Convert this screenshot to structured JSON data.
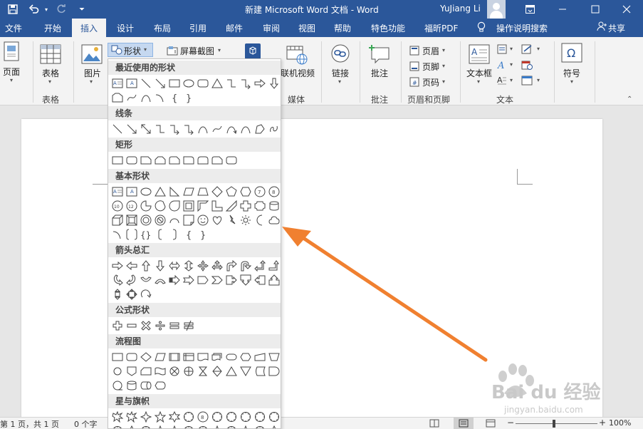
{
  "titlebar": {
    "doc_title": "新建 Microsoft Word 文档  -  Word",
    "user_name": "YuJiang Li",
    "icons": [
      "save-icon",
      "undo-icon",
      "redo-icon",
      "more-icon",
      "ribbon-options-icon",
      "minimize-icon",
      "maximize-icon",
      "close-icon"
    ]
  },
  "tabs": [
    "文件",
    "开始",
    "插入",
    "设计",
    "布局",
    "引用",
    "邮件",
    "审阅",
    "视图",
    "帮助",
    "特色功能",
    "福昕PDF"
  ],
  "tell_me": "操作说明搜索",
  "share": "共享",
  "ribbon": {
    "page": "页面",
    "table": "表格",
    "picture": "图片",
    "shapes_button": "形状",
    "screenshot": "屏幕截图",
    "online_video": "联机视频",
    "link": "链接",
    "comment": "批注",
    "header": "页眉",
    "footer": "页脚",
    "page_number": "页码",
    "textbox": "文本框",
    "symbol": "符号",
    "groups": {
      "table": "表格",
      "media": "媒体",
      "comments": "批注",
      "header_footer": "页眉和页脚",
      "text": "文本"
    }
  },
  "shapes_panel": {
    "sections": [
      "最近使用的形状",
      "线条",
      "矩形",
      "基本形状",
      "箭头总汇",
      "公式形状",
      "流程图",
      "星与旗帜"
    ],
    "extra_text": [
      "{",
      "}",
      "{",
      "}"
    ]
  },
  "statusbar": {
    "page_info": "第 1 页，共 1 页",
    "word_count": "0 个字",
    "zoom": "100%"
  },
  "watermark": {
    "brand": "Bai du 经验",
    "url": "jingyan.baidu.com"
  },
  "colors": {
    "word_blue": "#2b579a",
    "ribbon_bg": "#f3f3f3",
    "arrow": "#f08030"
  }
}
